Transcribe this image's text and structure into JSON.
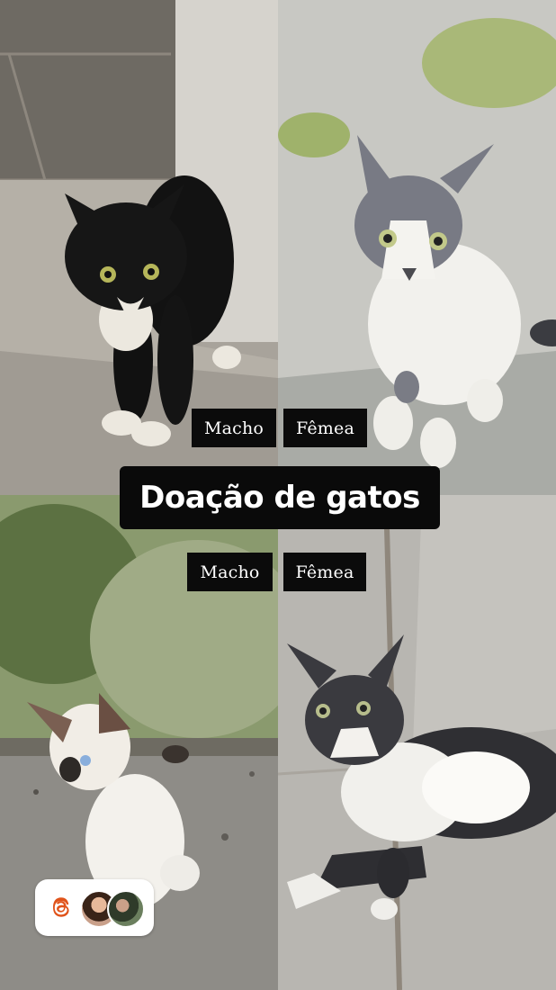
{
  "title": "Doação de gatos",
  "labels": {
    "top_left": "Macho",
    "top_right": "Fêmea",
    "bottom_left": "Macho",
    "bottom_right": "Fêmea"
  },
  "photos": [
    {
      "position": "top-left",
      "subject": "black and white kitten"
    },
    {
      "position": "top-right",
      "subject": "grey and white kitten"
    },
    {
      "position": "bottom-left",
      "subject": "siamese-colored white kitten"
    },
    {
      "position": "bottom-right",
      "subject": "grey and white kitten lying down"
    }
  ],
  "badge": {
    "icon": "threads-logo-icon"
  },
  "colors": {
    "label_bg": "#0b0b0b",
    "label_text": "#ffffff",
    "threads_accent": "#e0531a"
  }
}
